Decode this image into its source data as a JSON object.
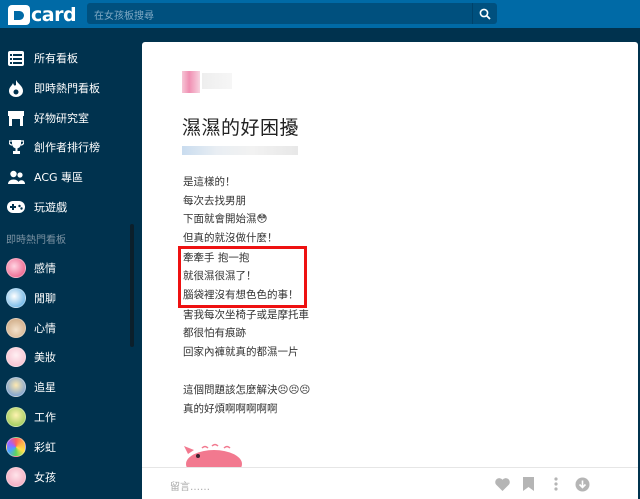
{
  "header": {
    "logo_text": "card",
    "search_placeholder": "在女孩板搜尋"
  },
  "sidebar": {
    "items": [
      {
        "label": "所有看板",
        "icon": "list-icon"
      },
      {
        "label": "即時熱門看板",
        "icon": "fire-icon"
      },
      {
        "label": "好物研究室",
        "icon": "store-icon"
      },
      {
        "label": "創作者排行榜",
        "icon": "trophy-icon"
      },
      {
        "label": "ACG 專區",
        "icon": "users-icon"
      },
      {
        "label": "玩遊戲",
        "icon": "gamepad-icon"
      }
    ],
    "section_title": "即時熱門看板",
    "boards": [
      {
        "label": "感情",
        "color": "#e94b7a"
      },
      {
        "label": "閒聊",
        "color": "#4aa3df"
      },
      {
        "label": "心情",
        "color": "#c9a27a"
      },
      {
        "label": "美妝",
        "color": "#f4b7c8"
      },
      {
        "label": "追星",
        "color": "#5b8fd8"
      },
      {
        "label": "工作",
        "color": "#8bc34a"
      },
      {
        "label": "彩虹",
        "color": "#ff5f5f"
      },
      {
        "label": "女孩",
        "color": "#f0a0b8"
      }
    ]
  },
  "post": {
    "title": "濕濕的好困擾",
    "lines": [
      "是這樣的！",
      "每次去找男朋",
      "下面就會開始濕😳",
      "但真的就沒做什麼！",
      "牽牽手 抱一抱",
      "就很濕很濕了！",
      "腦袋裡沒有想色色的事！",
      "害我每次坐椅子或是摩托車",
      "都很怕有痕跡",
      "回家內褲就真的都濕一片",
      "",
      "這個問題該怎麼解決😣😣😣",
      "真的好煩啊啊啊啊啊"
    ],
    "comment_placeholder": "留言……"
  },
  "colors": {
    "topbar": "#006aa6",
    "sidebar": "#00324e",
    "highlight": "#ee1111"
  }
}
